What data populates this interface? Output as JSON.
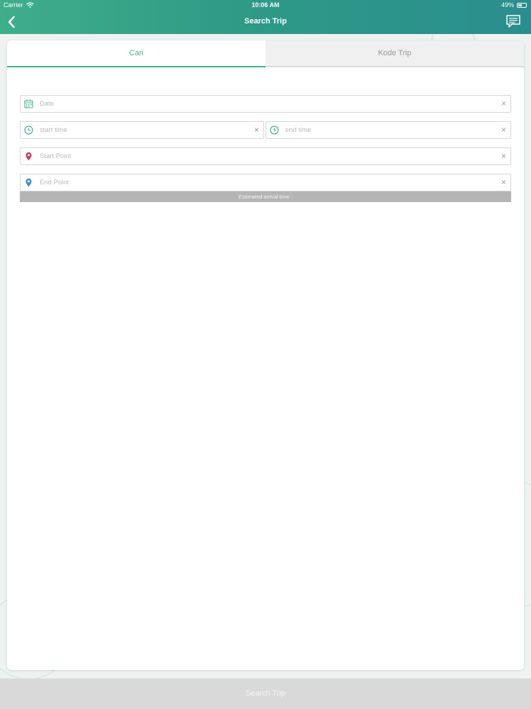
{
  "status_bar": {
    "carrier": "Carrier",
    "time": "10:06 AM",
    "battery": "49%"
  },
  "nav": {
    "title": "Search Trip",
    "back_icon": "chevron-left-icon",
    "chat_icon": "chat-bubble-icon"
  },
  "tabs": [
    {
      "label": "Cari",
      "active": true
    },
    {
      "label": "Kode Trip",
      "active": false
    }
  ],
  "form": {
    "date": {
      "placeholder": "Date",
      "icon": "calendar-icon",
      "value": ""
    },
    "start_time": {
      "placeholder": "start time",
      "icon": "clock-icon",
      "value": ""
    },
    "end_time": {
      "placeholder": "end time",
      "icon": "clock-icon",
      "value": ""
    },
    "start_point": {
      "placeholder": "Start Point",
      "icon": "map-pin-red-icon",
      "value": ""
    },
    "end_point": {
      "placeholder": "End Point",
      "icon": "map-pin-blue-icon",
      "value": ""
    },
    "clear_glyph": "×",
    "eta_label": "Estimated arrival time :"
  },
  "bottom_button": {
    "label": "Search Trip"
  },
  "colors": {
    "accent": "#3db58c",
    "header_start": "#3fae8a",
    "header_end": "#2a8e8e",
    "pin_red": "#d23b58",
    "pin_blue": "#3a8fc6"
  }
}
